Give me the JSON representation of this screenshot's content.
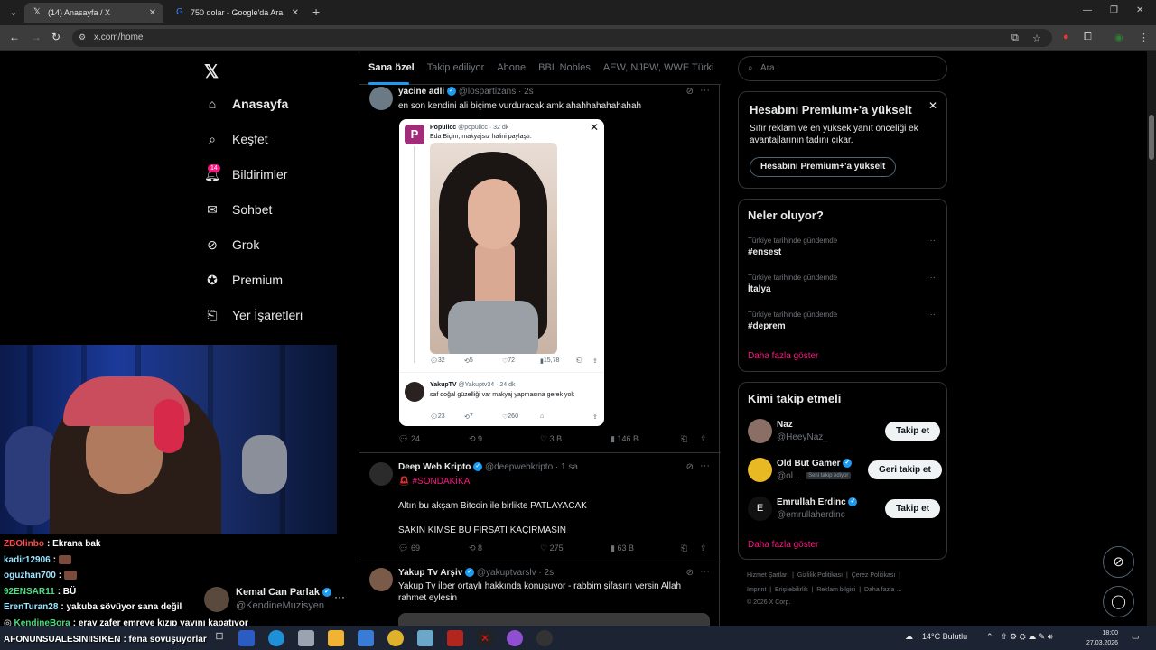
{
  "browser": {
    "tabs": [
      {
        "title": "(14) Anasayfa / X",
        "icon": "x-logo-icon"
      },
      {
        "title": "750 dolar - Google'da Ara",
        "icon": "google-icon"
      }
    ],
    "url": "x.com/home"
  },
  "nav": {
    "logo": "𝕏",
    "items": [
      {
        "label": "Anasayfa",
        "icon": "home-icon"
      },
      {
        "label": "Keşfet",
        "icon": "search-icon"
      },
      {
        "label": "Bildirimler",
        "icon": "bell-icon"
      },
      {
        "label": "Sohbet",
        "icon": "mail-icon"
      },
      {
        "label": "Grok",
        "icon": "grok-icon"
      },
      {
        "label": "Premium",
        "icon": "premium-icon"
      },
      {
        "label": "Yer İşaretleri",
        "icon": "bookmark-icon"
      }
    ],
    "notification_count": "14"
  },
  "account": {
    "name": "Kemal Can Parlak",
    "handle": "@KendineMuzisyen"
  },
  "chat": [
    {
      "user": "ZBOlinbo",
      "color": "#ff4a4a",
      "message": ": Ekrana bak"
    },
    {
      "user": "kadir12906",
      "color": "#9ce6ff",
      "message": ":"
    },
    {
      "user": "oguzhan700",
      "color": "#9ce6ff",
      "message": ":"
    },
    {
      "user": "92ENSAR11",
      "color": "#4ade80",
      "message": ": BÜ"
    },
    {
      "user": "ErenTuran28",
      "color": "#9ce6ff",
      "message": ": yakuba sövüyor sana değil"
    },
    {
      "user": "KendineBora",
      "color": "#4ade80",
      "message": ": eray zafer emreye kızıp yayını kapatıyor"
    },
    {
      "user": "AFONUNSUALESINIISIKEN",
      "color": "#ffffff",
      "message": ": fena sovuşuyorlar"
    }
  ],
  "feed": {
    "tabs": [
      "Sana özel",
      "Takip ediliyor",
      "Abone",
      "BBL Nobles",
      "AEW, NJPW, WWE Türki"
    ],
    "posts": [
      {
        "name": "yacine adli",
        "handle": "@lospartizans",
        "time": "· 2s",
        "text": "en son kendini ali biçime vurduracak amk ahahhahahahahah",
        "quote": {
          "name": "Populicc",
          "handle": "@populicc · 32 dk",
          "text": "Eda Biçim, makyajsız halini paylaştı.",
          "replies": "32",
          "reposts": "5",
          "likes": "72",
          "views": "15,78",
          "reply_name": "YakupTV",
          "reply_handle": "@Yakuptv34 · 24 dk",
          "reply_text": "saf doğal güzelliği var makyaj yapmasına gerek yok",
          "reply_replies": "23",
          "reply_reposts": "7",
          "reply_likes": "260"
        },
        "replies": "24",
        "reposts": "9",
        "likes": "3 B",
        "views": "146 B"
      },
      {
        "name": "Deep Web Kripto",
        "handle": "@deepwebkripto",
        "time": "· 1 sa",
        "tag": "#SONDAKİKA",
        "line1": "Altın bu akşam Bitcoin ile birlikte PATLAYACAK",
        "line2": "SAKIN KİMSE BU FIRSATI KAÇIRMASIN",
        "replies": "69",
        "reposts": "8",
        "likes": "275",
        "views": "63 B"
      },
      {
        "name": "Yakup Tv Arşiv",
        "handle": "@yakuptvarslv",
        "time": "· 2s",
        "text": "Yakup Tv ilber ortaylı hakkında konuşuyor - rabbim şifasını versin Allah rahmet eylesin"
      }
    ]
  },
  "right": {
    "search_placeholder": "Ara",
    "premium": {
      "title": "Hesabını Premium+'a yükselt",
      "desc": "Sıfır reklam ve en yüksek yanıt önceliği ek avantajlarının tadını çıkar.",
      "button": "Hesabını Premium+'a yükselt"
    },
    "trends": {
      "title": "Neler oluyor?",
      "items": [
        {
          "context": "Türkiye tarihinde gündemde",
          "name": "#ensest"
        },
        {
          "context": "Türkiye tarihinde gündemde",
          "name": "İtalya"
        },
        {
          "context": "Türkiye tarihinde gündemde",
          "name": "#deprem"
        }
      ],
      "show_more": "Daha fazla göster"
    },
    "who_to_follow": {
      "title": "Kimi takip etmeli",
      "items": [
        {
          "name": "Naz",
          "handle": "@HeeyNaz_",
          "button": "Takip et",
          "follows_you": ""
        },
        {
          "name": "Old But Gamer",
          "handle": "@ol...",
          "button": "Geri takip et",
          "follows_you": "Seni takip ediyor"
        },
        {
          "name": "Emrullah Erdinc",
          "handle": "@emrullaherdinc",
          "button": "Takip et",
          "follows_you": ""
        }
      ],
      "show_more": "Daha fazla göster"
    },
    "footer": {
      "line1": [
        "Hizmet Şartları",
        "Gizlilik Politikası",
        "Çerez Politikası"
      ],
      "line2": [
        "Imprint",
        "Erişilebilirlik",
        "Reklam bilgisi",
        "Daha fazla ..."
      ],
      "copyright": "© 2026 X Corp."
    }
  },
  "taskbar": {
    "weather": "14°C  Bulutlu",
    "time": "18:00",
    "date": "27.03.2026"
  }
}
